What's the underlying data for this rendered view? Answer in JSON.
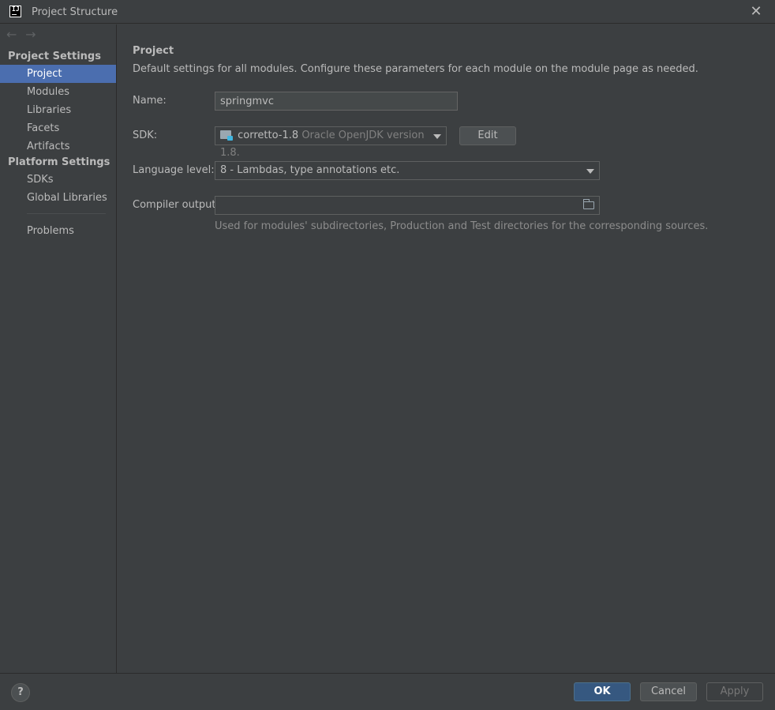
{
  "window": {
    "title": "Project Structure",
    "logo": "IJ",
    "close_glyph": "✕"
  },
  "nav": {
    "back_glyph": "←",
    "forward_glyph": "→"
  },
  "sidebar": {
    "project_settings_header": "Project Settings",
    "project_items": [
      {
        "label": "Project",
        "selected": true
      },
      {
        "label": "Modules"
      },
      {
        "label": "Libraries"
      },
      {
        "label": "Facets"
      },
      {
        "label": "Artifacts"
      }
    ],
    "platform_settings_header": "Platform Settings",
    "platform_items": [
      {
        "label": "SDKs"
      },
      {
        "label": "Global Libraries"
      }
    ],
    "problems_label": "Problems"
  },
  "main": {
    "title": "Project",
    "description": "Default settings for all modules. Configure these parameters for each module on the module page as needed.",
    "name_label": "Name:",
    "name_value": "springmvc",
    "sdk_label": "SDK:",
    "sdk_name": "corretto-1.8",
    "sdk_version": "Oracle OpenJDK version 1.8.",
    "edit_button": "Edit",
    "language_level_label": "Language level:",
    "language_level_value": "8 - Lambdas, type annotations etc.",
    "compiler_output_label": "Compiler output:",
    "compiler_output_value": "",
    "compiler_output_hint": "Used for modules' subdirectories, Production and Test directories for the corresponding sources."
  },
  "footer": {
    "help_glyph": "?",
    "ok_button": "OK",
    "cancel_button": "Cancel",
    "apply_button": "Apply"
  },
  "colors": {
    "background": "#3c3f41",
    "selection": "#4b6eaf",
    "primary_button": "#365880"
  }
}
